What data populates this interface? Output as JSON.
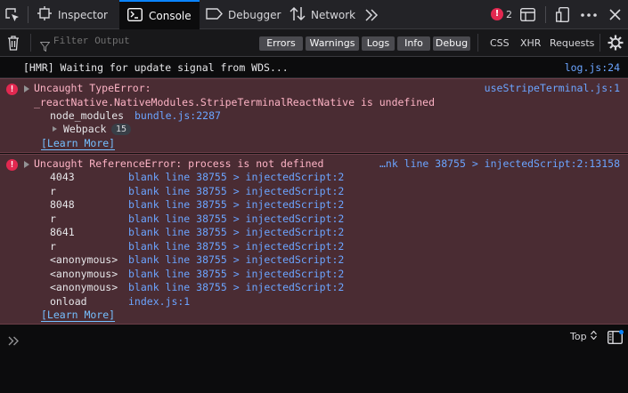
{
  "toolbar": {
    "tabs": [
      {
        "label": "Inspector"
      },
      {
        "label": "Console"
      },
      {
        "label": "Debugger"
      },
      {
        "label": "Network"
      }
    ],
    "error_count": "2"
  },
  "filterbar": {
    "placeholder": "Filter Output",
    "levels": [
      "Errors",
      "Warnings",
      "Logs",
      "Info",
      "Debug"
    ],
    "extras": [
      "CSS",
      "XHR",
      "Requests"
    ]
  },
  "messages": {
    "log": {
      "text": "[HMR] Waiting for update signal from WDS...",
      "source": "log.js:24"
    },
    "error1": {
      "line1": "Uncaught TypeError:",
      "line2": "_reactNative.NativeModules.StripeTerminalReactNative is undefined",
      "source": "useStripeTerminal.js:1",
      "stack_fn": "node_modules",
      "stack_loc": "bundle.js:2287",
      "group_label": "Webpack",
      "group_count": "15",
      "learn_more": "[Learn More]"
    },
    "error2": {
      "line1": "Uncaught ReferenceError: process is not defined",
      "source": "…nk line 38755 > injectedScript:2:13158",
      "stack": [
        {
          "fn": "4043",
          "loc": "blank line 38755 > injectedScript:2"
        },
        {
          "fn": "r",
          "loc": "blank line 38755 > injectedScript:2"
        },
        {
          "fn": "8048",
          "loc": "blank line 38755 > injectedScript:2"
        },
        {
          "fn": "r",
          "loc": "blank line 38755 > injectedScript:2"
        },
        {
          "fn": "8641",
          "loc": "blank line 38755 > injectedScript:2"
        },
        {
          "fn": "r",
          "loc": "blank line 38755 > injectedScript:2"
        },
        {
          "fn": "<anonymous>",
          "loc": "blank line 38755 > injectedScript:2"
        },
        {
          "fn": "<anonymous>",
          "loc": "blank line 38755 > injectedScript:2"
        },
        {
          "fn": "<anonymous>",
          "loc": "blank line 38755 > injectedScript:2"
        },
        {
          "fn": "onload",
          "loc": "index.js:1"
        }
      ],
      "learn_more": "[Learn More]"
    }
  },
  "input": {
    "context": "Top"
  },
  "colors": {
    "accent": "#0a84ff",
    "error": "#e22850",
    "error_bg": "#4a2c33",
    "link": "#6ba4ff"
  },
  "icons": [
    "pick-element-icon",
    "inspector-icon",
    "console-icon",
    "debugger-icon",
    "network-icon",
    "more-tabs-icon",
    "split-console-icon",
    "responsive-icon",
    "menu-icon",
    "close-icon",
    "trash-icon",
    "filter-icon",
    "settings-icon",
    "prompt-icon",
    "sidebar-icon"
  ]
}
